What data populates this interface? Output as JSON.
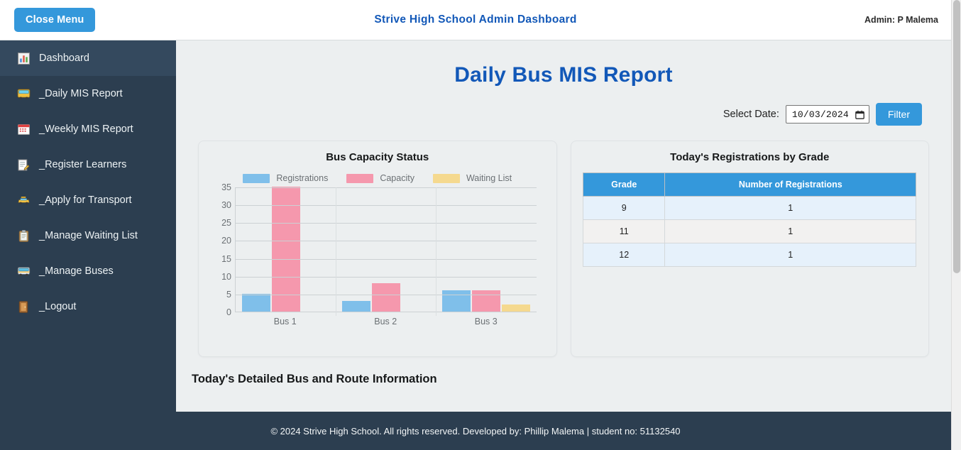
{
  "topbar": {
    "close_menu_label": "Close Menu",
    "title": "Strive High School Admin Dashboard",
    "admin_label": "Admin: P Malema",
    "accent_color": "#3498db",
    "title_color": "#1258b8"
  },
  "sidebar": {
    "background_color": "#2c3e50",
    "items": [
      {
        "label": "Dashboard",
        "icon": "bar-chart-icon",
        "active": true
      },
      {
        "label": "_Daily MIS Report",
        "icon": "bus-icon",
        "active": false
      },
      {
        "label": "_Weekly MIS Report",
        "icon": "calendar-icon",
        "active": false
      },
      {
        "label": "_Register Learners",
        "icon": "memo-pencil-icon",
        "active": false
      },
      {
        "label": "_Apply for Transport",
        "icon": "taxi-icon",
        "active": false
      },
      {
        "label": "_Manage Waiting List",
        "icon": "clipboard-icon",
        "active": false
      },
      {
        "label": "_Manage Buses",
        "icon": "trolleybus-icon",
        "active": false
      },
      {
        "label": "_Logout",
        "icon": "door-icon",
        "active": false
      }
    ]
  },
  "main": {
    "page_title": "Daily Bus MIS Report",
    "filter": {
      "label": "Select Date:",
      "date_value": "10/03/2024",
      "button_label": "Filter"
    },
    "chart_card_title": "Bus Capacity Status",
    "table_card_title": "Today's Registrations by Grade",
    "detail_heading": "Today's Detailed Bus and Route Information",
    "grade_table": {
      "columns": [
        "Grade",
        "Number of Registrations"
      ],
      "rows": [
        [
          "9",
          "1"
        ],
        [
          "11",
          "1"
        ],
        [
          "12",
          "1"
        ]
      ]
    }
  },
  "chart_data": {
    "type": "bar",
    "title": "Bus Capacity Status",
    "categories": [
      "Bus 1",
      "Bus 2",
      "Bus 3"
    ],
    "series": [
      {
        "name": "Registrations",
        "values": [
          5,
          3,
          6
        ],
        "color": "#7fbfea"
      },
      {
        "name": "Capacity",
        "values": [
          35,
          8,
          6
        ],
        "color": "#f598ad"
      },
      {
        "name": "Waiting List",
        "values": [
          0,
          0,
          2
        ],
        "color": "#f5d98f"
      }
    ],
    "xlabel": "",
    "ylabel": "",
    "ylim": [
      0,
      35
    ],
    "yticks": [
      0,
      5,
      10,
      15,
      20,
      25,
      30,
      35
    ],
    "grid": true,
    "legend_position": "top"
  },
  "footer": {
    "text": "© 2024 Strive High School. All rights reserved. Developed by: Phillip Malema | student no: 51132540"
  }
}
